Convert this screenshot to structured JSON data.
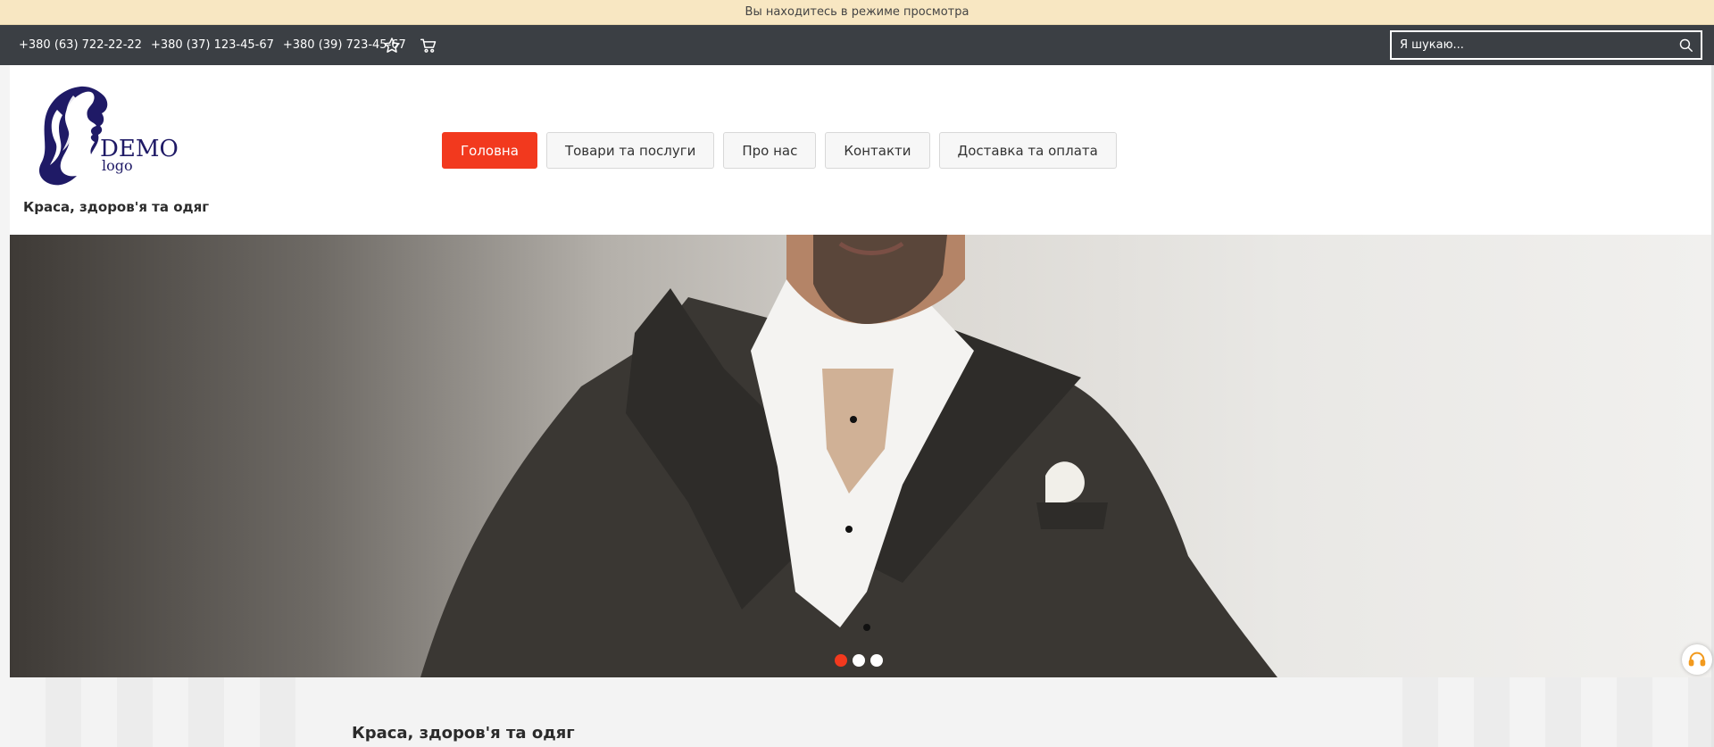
{
  "banner": {
    "text": "Вы находитесь в режиме просмотра"
  },
  "topbar": {
    "phones": [
      "+380 (63) 722-22-22",
      "+380 (37) 123-45-67",
      "+380 (39) 723-45-67"
    ],
    "icons": {
      "favorites": "star-icon",
      "cart": "cart-icon",
      "search": "search-icon"
    },
    "search": {
      "placeholder": "Я шукаю..."
    }
  },
  "header": {
    "logo": {
      "main_text": "DEMO",
      "sub_text": "logo"
    },
    "tagline": "Краса, здоров'я та одяг"
  },
  "nav": {
    "items": [
      {
        "label": "Головна",
        "active": true
      },
      {
        "label": "Товари та послуги",
        "active": false
      },
      {
        "label": "Про нас",
        "active": false
      },
      {
        "label": "Контакти",
        "active": false
      },
      {
        "label": "Доставка та оплата",
        "active": false
      }
    ]
  },
  "slider": {
    "slide_count": 3,
    "active_slide": 1
  },
  "content": {
    "section_title": "Краса, здоров'я та одяг"
  },
  "colors": {
    "accent": "#f2391e",
    "topbar": "#3b3f44",
    "banner": "#f8e7c2",
    "logo": "#1f1a66"
  }
}
